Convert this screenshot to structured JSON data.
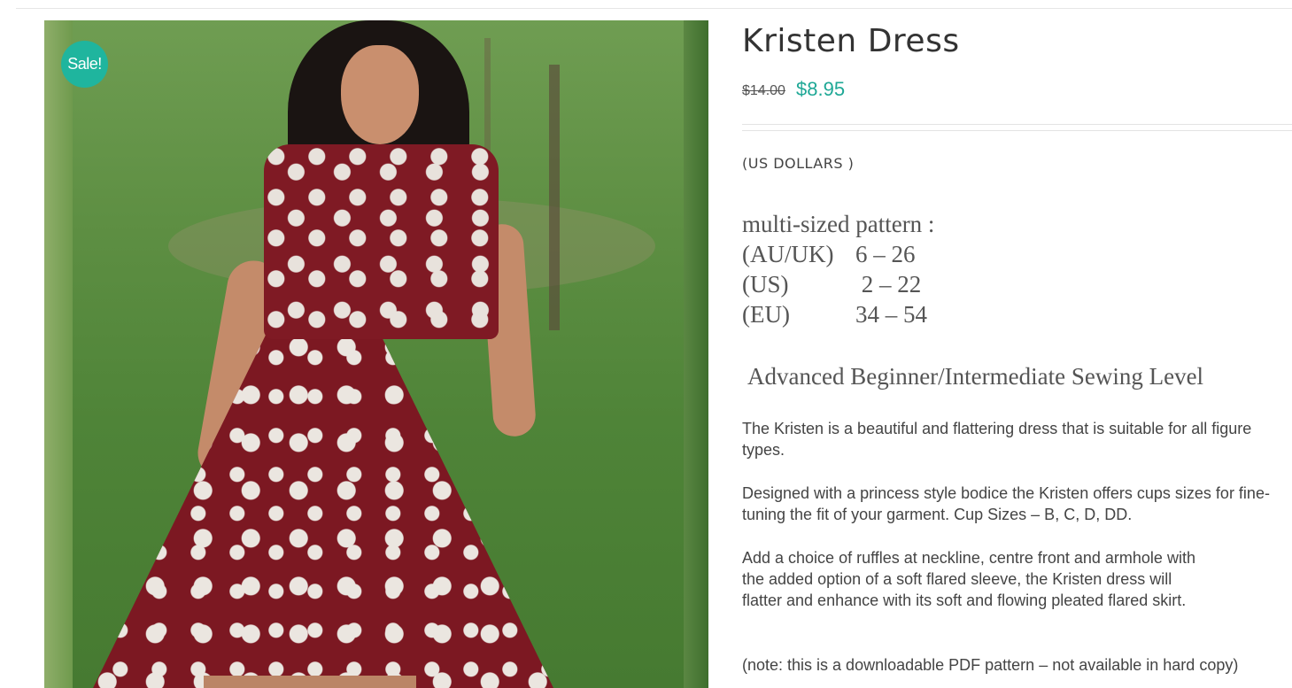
{
  "product": {
    "badge": "Sale!",
    "title": "Kristen Dress",
    "price_original": "$14.00",
    "price_sale": "$8.95",
    "currency_note": "(US DOLLARS )",
    "sizes_heading": "multi-sized pattern :",
    "sizes": [
      {
        "region": "(AU/UK)",
        "range": "6 – 26"
      },
      {
        "region": "(US)",
        "range": " 2 – 22"
      },
      {
        "region": "(EU)",
        "range": "34 – 54"
      }
    ],
    "sewing_level": "Advanced Beginner/Intermediate Sewing Level",
    "description": [
      "The Kristen is a beautiful and flattering dress that is suitable for all figure types.",
      "Designed with a princess style bodice the Kristen offers cups sizes for fine-tuning the fit of your garment. Cup Sizes – B, C, D, DD.",
      "Add a choice of ruffles at neckline, centre front and armhole with the added option of a soft flared sleeve, the Kristen dress will flatter and enhance with its soft and flowing pleated flared skirt.",
      "(note: this is a downloadable PDF pattern – not available in hard copy)"
    ]
  },
  "colors": {
    "accent": "#1fa896",
    "badge": "#1fb59e",
    "dress": "#7c1822"
  }
}
